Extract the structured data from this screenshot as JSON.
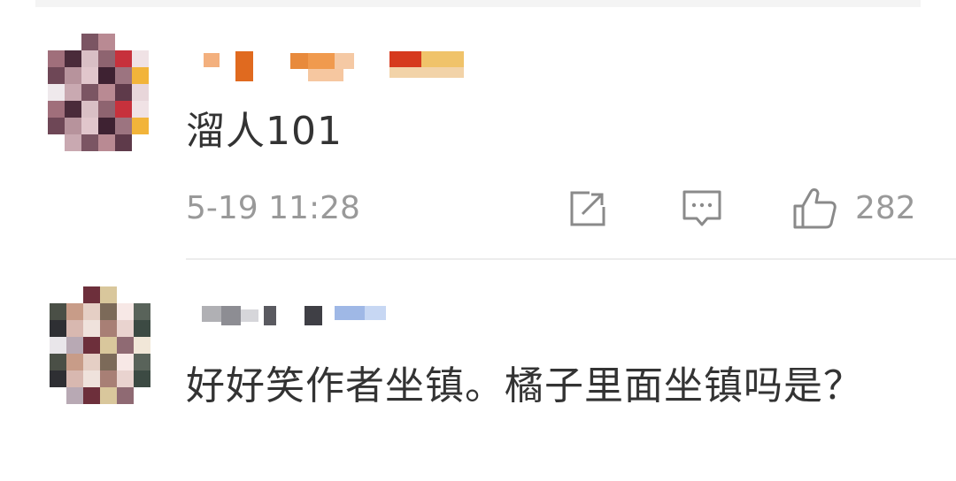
{
  "comments": [
    {
      "text": "溜人101",
      "timestamp": "5-19 11:28",
      "like_count": "282",
      "actions": {
        "share_icon": "share-icon",
        "reply_icon": "comment-icon",
        "like_icon": "thumbs-up-icon"
      }
    },
    {
      "text": "好好笑作者坐镇。橘子里面坐镇吗是？"
    }
  ],
  "colors": {
    "text_primary": "#333333",
    "text_secondary": "#999999",
    "divider": "#ececec"
  }
}
